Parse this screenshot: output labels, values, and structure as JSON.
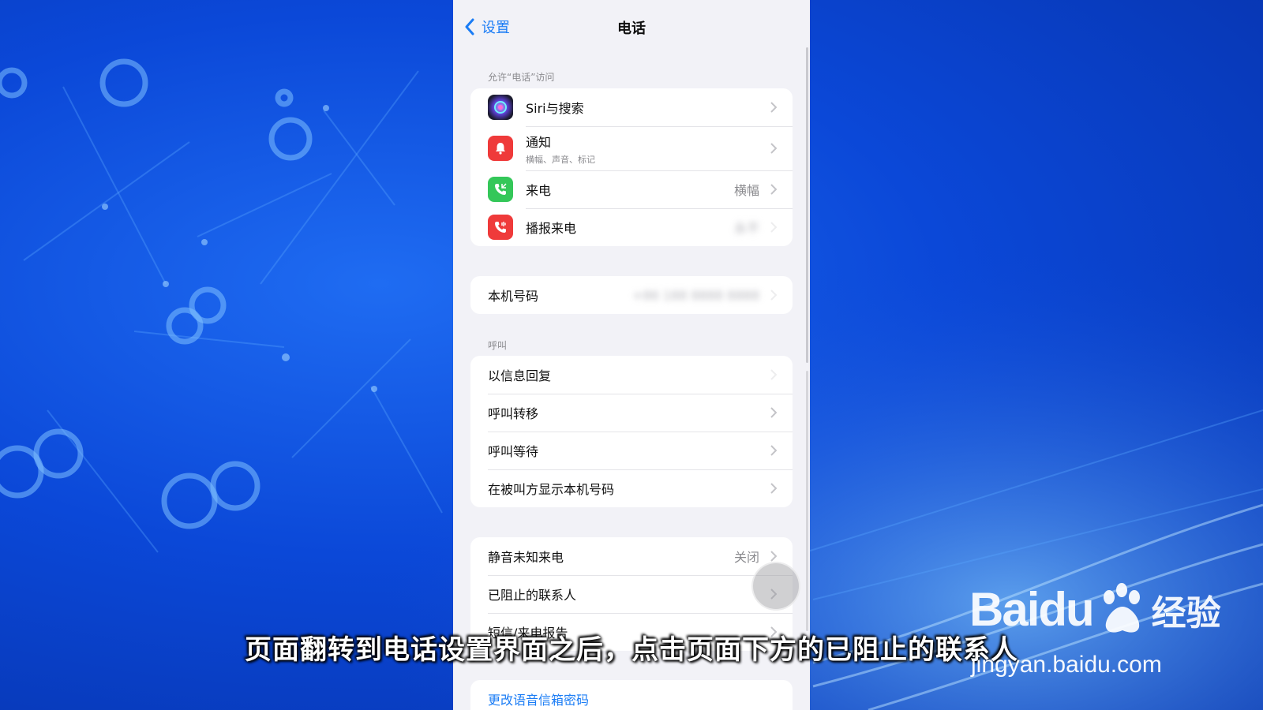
{
  "nav": {
    "back_label": "设置",
    "title": "电话"
  },
  "sections": {
    "allow_access_header": "允许“电话”访问",
    "call_header": "呼叫"
  },
  "access_rows": [
    {
      "label": "Siri与搜索",
      "icon": "siri-icon"
    },
    {
      "label": "通知",
      "sublabel": "横幅、声音、标记",
      "icon": "bell-icon"
    },
    {
      "label": "来电",
      "value": "横幅",
      "icon": "incoming-call-icon"
    },
    {
      "label": "播报来电",
      "value": "永不",
      "icon": "announce-call-icon"
    }
  ],
  "my_number": {
    "label": "本机号码",
    "value": "+86 188 8888 8888"
  },
  "call_rows": [
    {
      "label": "以信息回复"
    },
    {
      "label": "呼叫转移"
    },
    {
      "label": "呼叫等待"
    },
    {
      "label": "在被叫方显示本机号码"
    }
  ],
  "silence_rows": [
    {
      "label": "静音未知来电",
      "value": "关闭"
    },
    {
      "label": "已阻止的联系人"
    },
    {
      "label": "短信/来电报告"
    }
  ],
  "voicemail": {
    "label": "更改语音信箱密码"
  },
  "caption": "页面翻转到电话设置界面之后，点击页面下方的已阻止的联系人",
  "watermark": {
    "brand": "Baidu",
    "product": "经验",
    "url": "jingyan.baidu.com"
  },
  "colors": {
    "accent": "#1a7cf5",
    "notification_icon": "#ef3a3a",
    "incoming_call_icon": "#34c759",
    "announce_icon": "#ef3a3a"
  }
}
